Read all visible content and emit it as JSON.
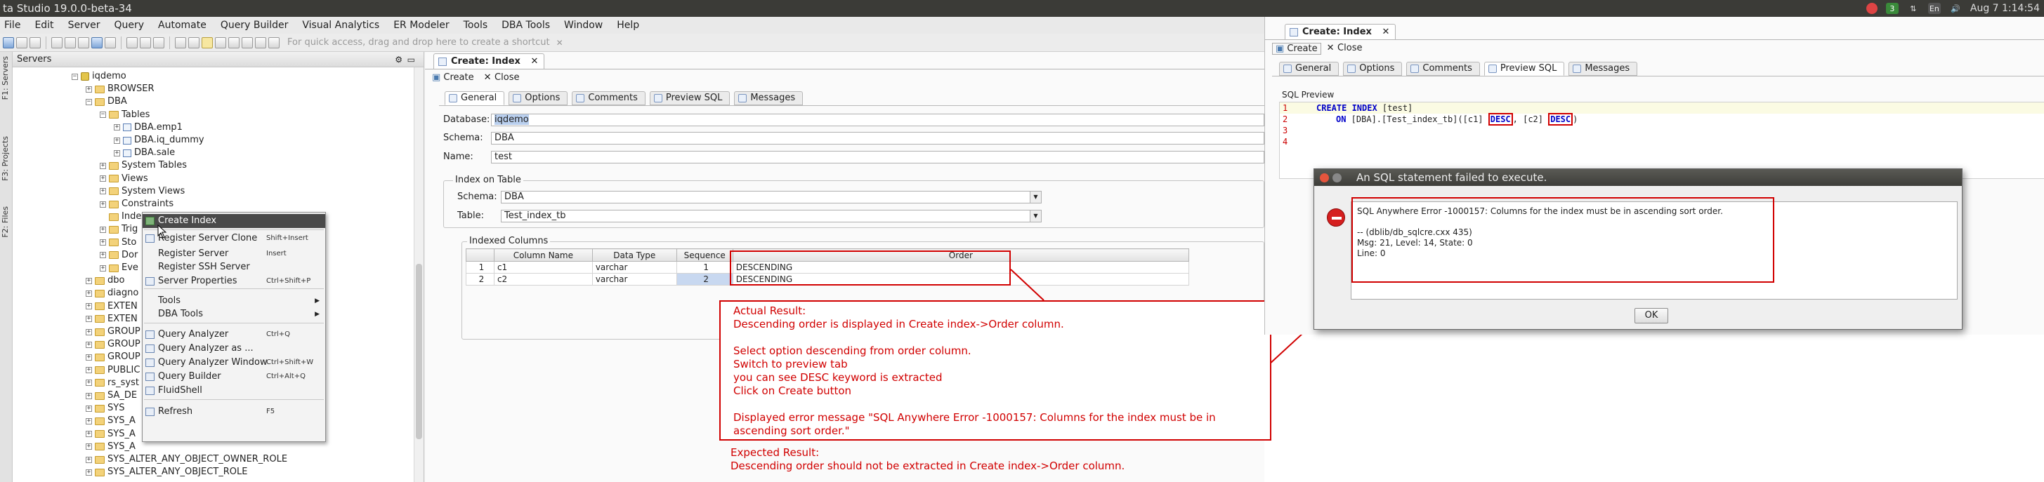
{
  "window": {
    "title": "ta Studio 19.0.0-beta-34",
    "clock": "Aug 7  1:14:54",
    "tray": {
      "badge_count": "3",
      "keyboard_layout": "En"
    }
  },
  "menubar": [
    "File",
    "Edit",
    "Server",
    "Query",
    "Automate",
    "Query Builder",
    "Visual Analytics",
    "ER Modeler",
    "Tools",
    "DBA Tools",
    "Window",
    "Help"
  ],
  "toolbar": {
    "quick_access_placeholder": "For quick access, drag and drop here to create a shortcut"
  },
  "side_tabs": [
    "F1: Servers",
    "F3: Projects",
    "F2: Files"
  ],
  "servers_panel": {
    "title": "Servers",
    "tree": [
      {
        "label": "iqdemo",
        "icon": "database-icon",
        "expander": "−"
      },
      {
        "label": "BROWSER",
        "icon": "folder-icon",
        "expander": "+"
      },
      {
        "label": "DBA",
        "icon": "folder-icon",
        "expander": "−"
      },
      {
        "label": "Tables",
        "icon": "folder-icon",
        "expander": "−"
      },
      {
        "label": "DBA.emp1",
        "icon": "table-icon",
        "expander": "+"
      },
      {
        "label": "DBA.iq_dummy",
        "icon": "table-icon",
        "expander": "+"
      },
      {
        "label": "DBA.sale",
        "icon": "table-icon",
        "expander": "+"
      },
      {
        "label": "System Tables",
        "icon": "folder-icon",
        "expander": "+"
      },
      {
        "label": "Views",
        "icon": "folder-icon",
        "expander": "+"
      },
      {
        "label": "System Views",
        "icon": "folder-icon",
        "expander": "+"
      },
      {
        "label": "Constraints",
        "icon": "folder-icon",
        "expander": "+"
      },
      {
        "label": "Indexes",
        "icon": "folder-icon",
        "expander": ""
      },
      {
        "label": "Trig",
        "icon": "folder-icon",
        "expander": "+"
      },
      {
        "label": "Sto",
        "icon": "folder-icon",
        "expander": "+"
      },
      {
        "label": "Dor",
        "icon": "folder-icon",
        "expander": "+"
      },
      {
        "label": "Eve",
        "icon": "folder-icon",
        "expander": "+"
      },
      {
        "label": "dbo",
        "icon": "folder-icon",
        "expander": "+"
      },
      {
        "label": "diagno",
        "icon": "folder-icon",
        "expander": "+"
      },
      {
        "label": "EXTEN",
        "icon": "folder-icon",
        "expander": "+"
      },
      {
        "label": "EXTEN",
        "icon": "folder-icon",
        "expander": "+"
      },
      {
        "label": "GROUP",
        "icon": "folder-icon",
        "expander": "+"
      },
      {
        "label": "GROUP",
        "icon": "folder-icon",
        "expander": "+"
      },
      {
        "label": "GROUP",
        "icon": "folder-icon",
        "expander": "+"
      },
      {
        "label": "PUBLIC",
        "icon": "folder-icon",
        "expander": "+"
      },
      {
        "label": "rs_syst",
        "icon": "folder-icon",
        "expander": "+"
      },
      {
        "label": "SA_DE",
        "icon": "folder-icon",
        "expander": "+"
      },
      {
        "label": "SYS",
        "icon": "folder-icon",
        "expander": "+"
      },
      {
        "label": "SYS_A",
        "icon": "folder-icon",
        "expander": "+"
      },
      {
        "label": "SYS_A",
        "icon": "folder-icon",
        "expander": "+"
      },
      {
        "label": "SYS_A",
        "icon": "folder-icon",
        "expander": "+"
      },
      {
        "label": "SYS_ALTER_ANY_OBJECT_OWNER_ROLE",
        "icon": "folder-icon",
        "expander": "+"
      },
      {
        "label": "SYS_ALTER_ANY_OBJECT_ROLE",
        "icon": "folder-icon",
        "expander": "+"
      }
    ]
  },
  "context_menu": {
    "items": [
      {
        "label": "Create Index",
        "shortcut": "",
        "submenu": false,
        "icon": "create-index-icon"
      },
      {
        "label": "Register Server Clone",
        "shortcut": "Shift+Insert",
        "submenu": false,
        "icon": "server-clone-icon"
      },
      {
        "label": "Register Server",
        "shortcut": "Insert",
        "submenu": false,
        "icon": ""
      },
      {
        "label": "Register SSH Server",
        "shortcut": "",
        "submenu": false,
        "icon": ""
      },
      {
        "label": "Server Properties",
        "shortcut": "Ctrl+Shift+P",
        "submenu": false,
        "icon": "properties-icon"
      },
      {
        "label": "Tools",
        "shortcut": "",
        "submenu": true,
        "icon": ""
      },
      {
        "label": "DBA Tools",
        "shortcut": "",
        "submenu": true,
        "icon": ""
      },
      {
        "label": "Query Analyzer",
        "shortcut": "Ctrl+Q",
        "submenu": false,
        "icon": "query-analyzer-icon"
      },
      {
        "label": "Query Analyzer as ...",
        "shortcut": "",
        "submenu": false,
        "icon": "query-analyzer-as-icon"
      },
      {
        "label": "Query Analyzer Window",
        "shortcut": "Ctrl+Shift+W",
        "submenu": false,
        "icon": "query-window-icon"
      },
      {
        "label": "Query Builder",
        "shortcut": "Ctrl+Alt+Q",
        "submenu": false,
        "icon": "query-builder-icon"
      },
      {
        "label": "FluidShell",
        "shortcut": "",
        "submenu": false,
        "icon": "fluidshell-icon"
      },
      {
        "label": "Refresh",
        "shortcut": "F5",
        "submenu": false,
        "icon": "refresh-icon"
      }
    ]
  },
  "editor": {
    "doc_tab": "Create: Index",
    "actions": {
      "create": "Create",
      "close": "Close"
    },
    "tabs": [
      "General",
      "Options",
      "Comments",
      "Preview SQL",
      "Messages"
    ],
    "general": {
      "database_label": "Database:",
      "database_value": "iqdemo",
      "schema_label": "Schema:",
      "schema_value": "DBA",
      "name_label": "Name:",
      "name_value": "test",
      "index_on_table_title": "Index on Table",
      "table_schema_label": "Schema:",
      "table_schema_value": "DBA",
      "table_label": "Table:",
      "table_value": "Test_index_tb",
      "indexed_columns_title": "Indexed Columns",
      "columns": {
        "headers": [
          "",
          "Column Name",
          "Data Type",
          "Sequence",
          "Order"
        ],
        "rows": [
          [
            "1",
            "c1",
            "varchar",
            "1",
            "DESCENDING"
          ],
          [
            "2",
            "c2",
            "varchar",
            "2",
            "DESCENDING"
          ]
        ]
      }
    }
  },
  "annotation": {
    "actual_result_title": "Actual Result:",
    "actual_result_text": "Descending order is displayed in Create index->Order column.",
    "steps": [
      "Select option descending from order column.",
      "Switch to preview tab",
      "you can see DESC keyword is extracted",
      "Click on Create button"
    ],
    "error_line_1": "Displayed error message \"SQL Anywhere Error -1000157: Columns for the index must be in",
    "error_line_2": "ascending sort order.\"",
    "expected_title": "Expected Result:",
    "expected_text": "Descending order should not be extracted in Create index->Order column."
  },
  "right_panel": {
    "doc_tab": "Create: Index",
    "actions": {
      "create": "Create",
      "close": "Close"
    },
    "tabs": [
      "General",
      "Options",
      "Comments",
      "Preview SQL",
      "Messages"
    ],
    "sql_preview_label": "SQL Preview",
    "sql": {
      "line_numbers": [
        "1",
        "2",
        "3",
        "4"
      ],
      "kw_create_index": "CREATE INDEX",
      "index_name": " [test]",
      "kw_on": "ON",
      "on_text": " [DBA].[Test_index_tb]([c1] ",
      "desc1": "DESC",
      "mid": ", [c2] ",
      "desc2": "DESC",
      "tail": ")"
    }
  },
  "dialog": {
    "title": "An SQL statement failed to execute.",
    "message": "SQL Anywhere Error -1000157: Columns for the index must be in ascending sort order.",
    "detail_1": "-- (dblib/db_sqlcre.cxx 435)",
    "detail_2": "Msg: 21, Level: 14, State: 0",
    "detail_3": "Line: 0",
    "ok": "OK"
  },
  "colors": {
    "annotation_red": "#d10000",
    "sql_keyword": "#0000c8",
    "selection": "#4a4a4a"
  }
}
